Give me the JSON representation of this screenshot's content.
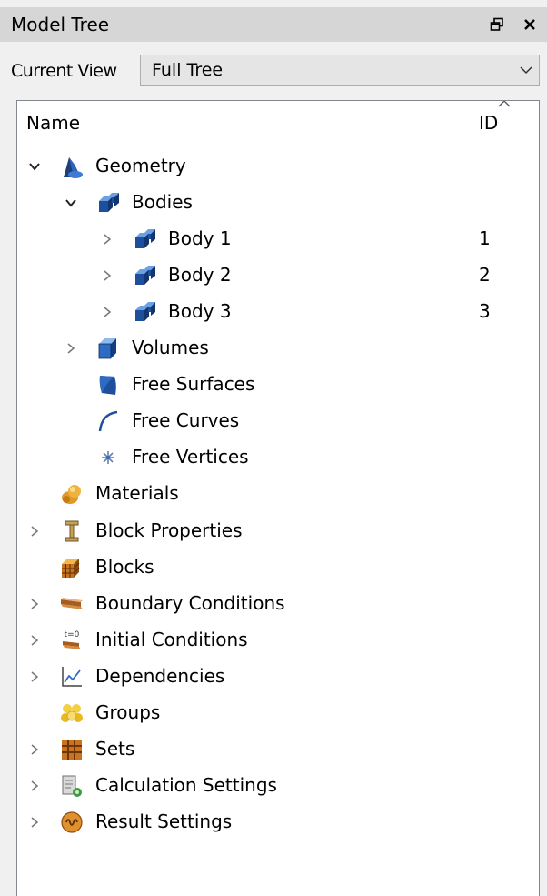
{
  "panel": {
    "title": "Model Tree"
  },
  "view": {
    "label": "Current View",
    "selected": "Full Tree"
  },
  "columns": {
    "name": "Name",
    "id": "ID"
  },
  "tree": [
    {
      "label": "Geometry",
      "id": "",
      "level": 0,
      "expander": "expanded",
      "icon": "geometry-icon"
    },
    {
      "label": "Bodies",
      "id": "",
      "level": 1,
      "expander": "expanded",
      "icon": "bodies-icon"
    },
    {
      "label": "Body 1",
      "id": "1",
      "level": 2,
      "expander": "collapsed",
      "icon": "body-icon"
    },
    {
      "label": "Body 2",
      "id": "2",
      "level": 2,
      "expander": "collapsed",
      "icon": "body-icon"
    },
    {
      "label": "Body 3",
      "id": "3",
      "level": 2,
      "expander": "collapsed",
      "icon": "body-icon"
    },
    {
      "label": "Volumes",
      "id": "",
      "level": 1,
      "expander": "collapsed",
      "icon": "volume-cube-icon"
    },
    {
      "label": "Free Surfaces",
      "id": "",
      "level": 1,
      "expander": "none",
      "icon": "surface-icon"
    },
    {
      "label": "Free Curves",
      "id": "",
      "level": 1,
      "expander": "none",
      "icon": "curve-icon"
    },
    {
      "label": "Free Vertices",
      "id": "",
      "level": 1,
      "expander": "none",
      "icon": "vertex-icon"
    },
    {
      "label": "Materials",
      "id": "",
      "level": 0,
      "expander": "none",
      "icon": "materials-icon"
    },
    {
      "label": "Block Properties",
      "id": "",
      "level": 0,
      "expander": "collapsed",
      "icon": "i-beam-icon"
    },
    {
      "label": "Blocks",
      "id": "",
      "level": 0,
      "expander": "none",
      "icon": "blocks-icon"
    },
    {
      "label": "Boundary Conditions",
      "id": "",
      "level": 0,
      "expander": "collapsed",
      "icon": "boundary-conditions-icon"
    },
    {
      "label": "Initial Conditions",
      "id": "",
      "level": 0,
      "expander": "collapsed",
      "icon": "initial-conditions-icon"
    },
    {
      "label": "Dependencies",
      "id": "",
      "level": 0,
      "expander": "collapsed",
      "icon": "dependencies-chart-icon"
    },
    {
      "label": "Groups",
      "id": "",
      "level": 0,
      "expander": "none",
      "icon": "groups-icon"
    },
    {
      "label": "Sets",
      "id": "",
      "level": 0,
      "expander": "collapsed",
      "icon": "sets-grid-icon"
    },
    {
      "label": "Calculation Settings",
      "id": "",
      "level": 0,
      "expander": "collapsed",
      "icon": "calculation-settings-icon"
    },
    {
      "label": "Result Settings",
      "id": "",
      "level": 0,
      "expander": "collapsed",
      "icon": "result-settings-icon"
    }
  ],
  "icon_text": {
    "initial_conditions": "t=0"
  }
}
